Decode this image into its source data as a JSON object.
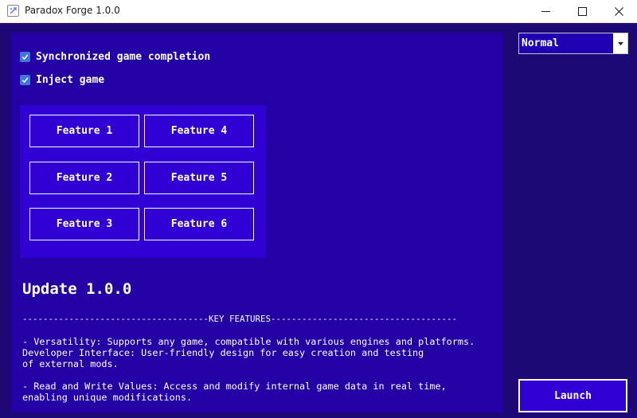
{
  "window": {
    "title": "Paradox Forge 1.0.0",
    "icon": "app-logo-icon",
    "controls": [
      "minimize-icon",
      "maximize-icon",
      "close-icon"
    ]
  },
  "options": {
    "sync_label": "Synchronized game completion",
    "sync_checked": true,
    "inject_label": "Inject game",
    "inject_checked": true
  },
  "features": [
    "Feature 1",
    "Feature 2",
    "Feature 3",
    "Feature 4",
    "Feature 5",
    "Feature 6"
  ],
  "update": {
    "title": "Update 1.0.0",
    "divider": "------------------------------------KEY FEATURES------------------------------------",
    "notes": "- Versatility: Supports any game, compatible with various engines and platforms.\nDeveloper Interface: User-friendly design for easy creation and testing\nof external mods.\n\n- Read and Write Values: Access and modify internal game data in real time,\nenabling unique modifications."
  },
  "mode": {
    "selected": "Normal"
  },
  "launch_label": "Launch",
  "colors": {
    "background": "#1d0876",
    "panel": "#2401a4",
    "feature_box": "#3000d5",
    "checkbox": "#3d78e0",
    "text": "#ffffff"
  }
}
